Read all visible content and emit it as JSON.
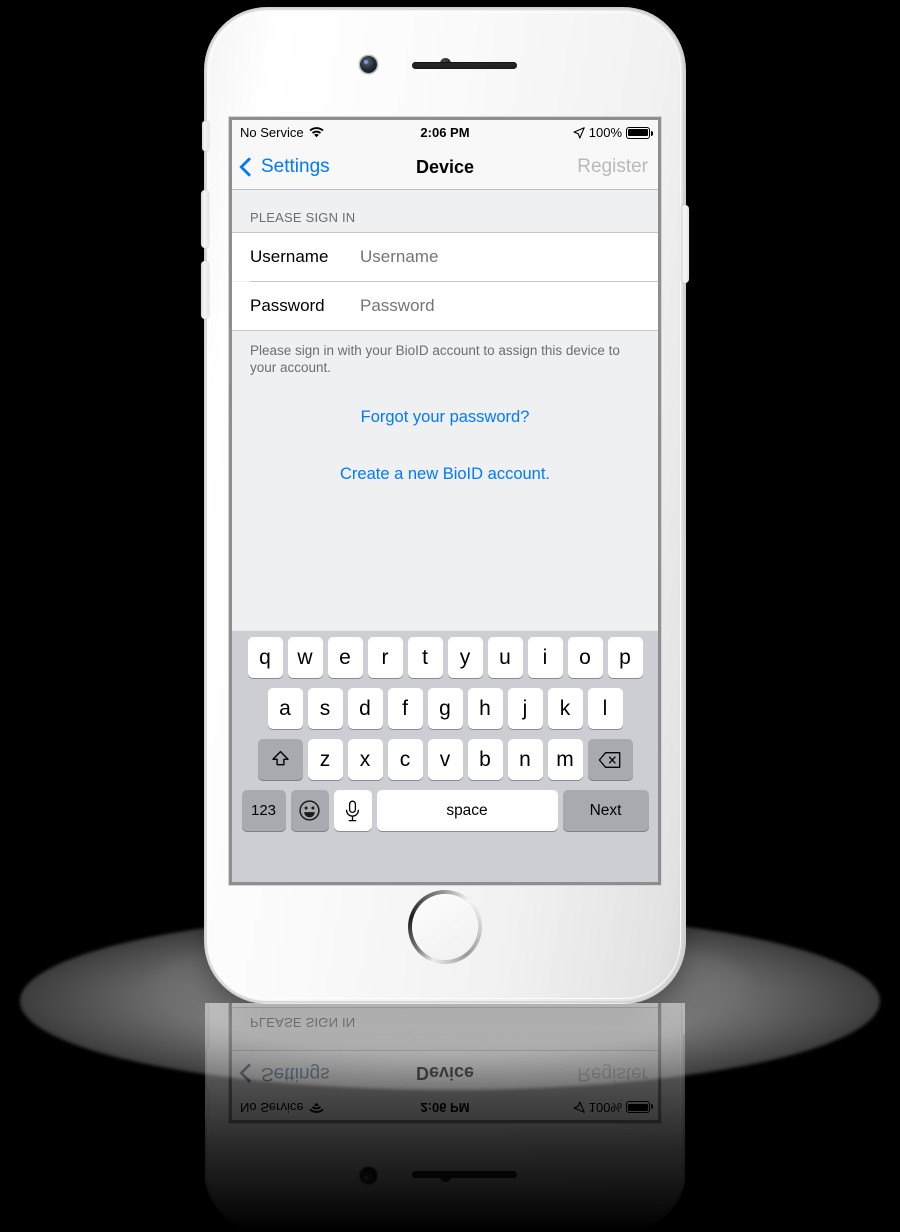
{
  "device": {
    "name": "iPhone",
    "color": "silver-white",
    "icons": {
      "front_camera": "camera-icon",
      "proximity_sensor": "sensor-icon",
      "earpiece": "speaker-grille-icon",
      "home": "home-button-icon"
    }
  },
  "status_bar": {
    "carrier": "No Service",
    "wifi_icon": "wifi-icon",
    "time": "2:06 PM",
    "location_icon": "location-arrow-icon",
    "battery_percent": "100%",
    "battery_icon": "battery-full-icon"
  },
  "nav_bar": {
    "back_label": "Settings",
    "back_icon": "chevron-left-icon",
    "title": "Device",
    "right_action": "Register"
  },
  "form": {
    "section_header": "PLEASE SIGN IN",
    "fields": [
      {
        "label": "Username",
        "value": "",
        "placeholder": "Username"
      },
      {
        "label": "Password",
        "value": "",
        "placeholder": "Password"
      }
    ],
    "footnote": "Please sign in with your BioID account to assign this device to your account.",
    "links": [
      "Forgot your password?",
      "Create a new BioID account."
    ]
  },
  "keyboard": {
    "row1": [
      "q",
      "w",
      "e",
      "r",
      "t",
      "y",
      "u",
      "i",
      "o",
      "p"
    ],
    "row2": [
      "a",
      "s",
      "d",
      "f",
      "g",
      "h",
      "j",
      "k",
      "l"
    ],
    "row3": [
      "z",
      "x",
      "c",
      "v",
      "b",
      "n",
      "m"
    ],
    "shift_icon": "shift-arrow-icon",
    "backspace_icon": "backspace-delete-icon",
    "numbers_key": "123",
    "emoji_icon": "smiley-emoji-icon",
    "dictation_icon": "microphone-icon",
    "space_key": "space",
    "return_key": "Next"
  },
  "colors": {
    "tint_blue": "#007aff",
    "disabled_gray": "#b9b9bd",
    "table_bg": "#eff0f2",
    "cell_bg": "#ffffff",
    "keyboard_bg": "#ccced3",
    "key_dark": "#a8aab0",
    "footnote_gray": "#6d6d72",
    "backdrop": "#000000"
  }
}
